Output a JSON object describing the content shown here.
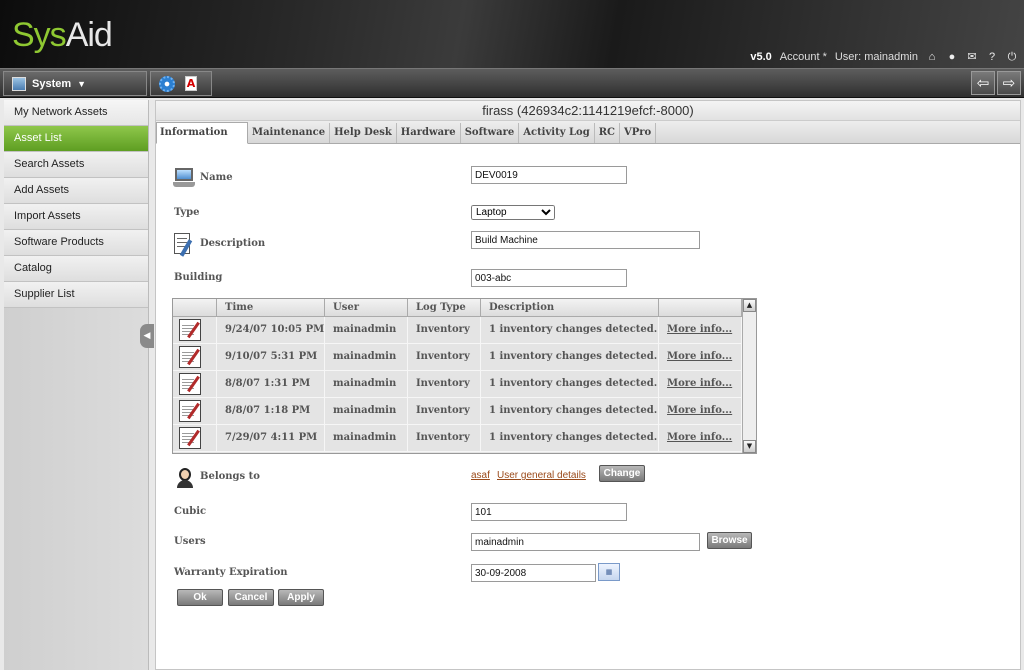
{
  "app": {
    "logo_sys": "Sys",
    "logo_aid": "Aid"
  },
  "top_links": {
    "version": "v5.0",
    "account": "Account *",
    "user": "User: mainadmin"
  },
  "toolbar": {
    "system_label": "System",
    "system_arrow": "▼"
  },
  "sidebar": {
    "items": [
      {
        "label": "My Network Assets"
      },
      {
        "label": "Asset List",
        "active": true
      },
      {
        "label": "Search Assets"
      },
      {
        "label": "Add Assets"
      },
      {
        "label": "Import Assets"
      },
      {
        "label": "Software Products"
      },
      {
        "label": "Catalog"
      },
      {
        "label": "Supplier List"
      }
    ]
  },
  "asset": {
    "title": "firass (426934c2:1141219efcf:-8000)"
  },
  "tabs": [
    "Information",
    "Maintenance",
    "Help Desk",
    "Hardware",
    "Software",
    "Activity Log",
    "RC",
    "VPro"
  ],
  "form": {
    "name_label": "Name",
    "name_value": "DEV0019",
    "type_label": "Type",
    "type_value": "Laptop",
    "description_label": "Description",
    "description_value": "Build Machine",
    "building_label": "Building",
    "building_value": "003-abc",
    "belongs_label": "Belongs to",
    "belongs_user": "asaf",
    "belongs_details": "User general details",
    "change_button": "Change",
    "cubic_label": "Cubic",
    "cubic_value": "101",
    "users_label": "Users",
    "users_value": "mainadmin",
    "browse_button": "Browse",
    "warranty_label": "Warranty Expiration",
    "warranty_value": "30-09-2008"
  },
  "log_table": {
    "headers": [
      "Time",
      "User",
      "Log Type",
      "Description"
    ],
    "rows": [
      {
        "time": "9/24/07 10:05 PM",
        "user": "mainadmin",
        "type": "Inventory",
        "description": "1 inventory changes detected.",
        "link": "More info..."
      },
      {
        "time": "9/10/07 5:31 PM",
        "user": "mainadmin",
        "type": "Inventory",
        "description": "1 inventory changes detected.",
        "link": "More info..."
      },
      {
        "time": "8/8/07 1:31 PM",
        "user": "mainadmin",
        "type": "Inventory",
        "description": "1 inventory changes detected.",
        "link": "More info..."
      },
      {
        "time": "8/8/07 1:18 PM",
        "user": "mainadmin",
        "type": "Inventory",
        "description": "1 inventory changes detected.",
        "link": "More info..."
      },
      {
        "time": "7/29/07 4:11 PM",
        "user": "mainadmin",
        "type": "Inventory",
        "description": "1 inventory changes detected.",
        "link": "More info..."
      }
    ]
  },
  "actions": {
    "ok": "Ok",
    "cancel": "Cancel",
    "apply": "Apply"
  },
  "colors": {
    "accent_green": "#6fb22e",
    "link_brown": "#9a4a1a"
  }
}
